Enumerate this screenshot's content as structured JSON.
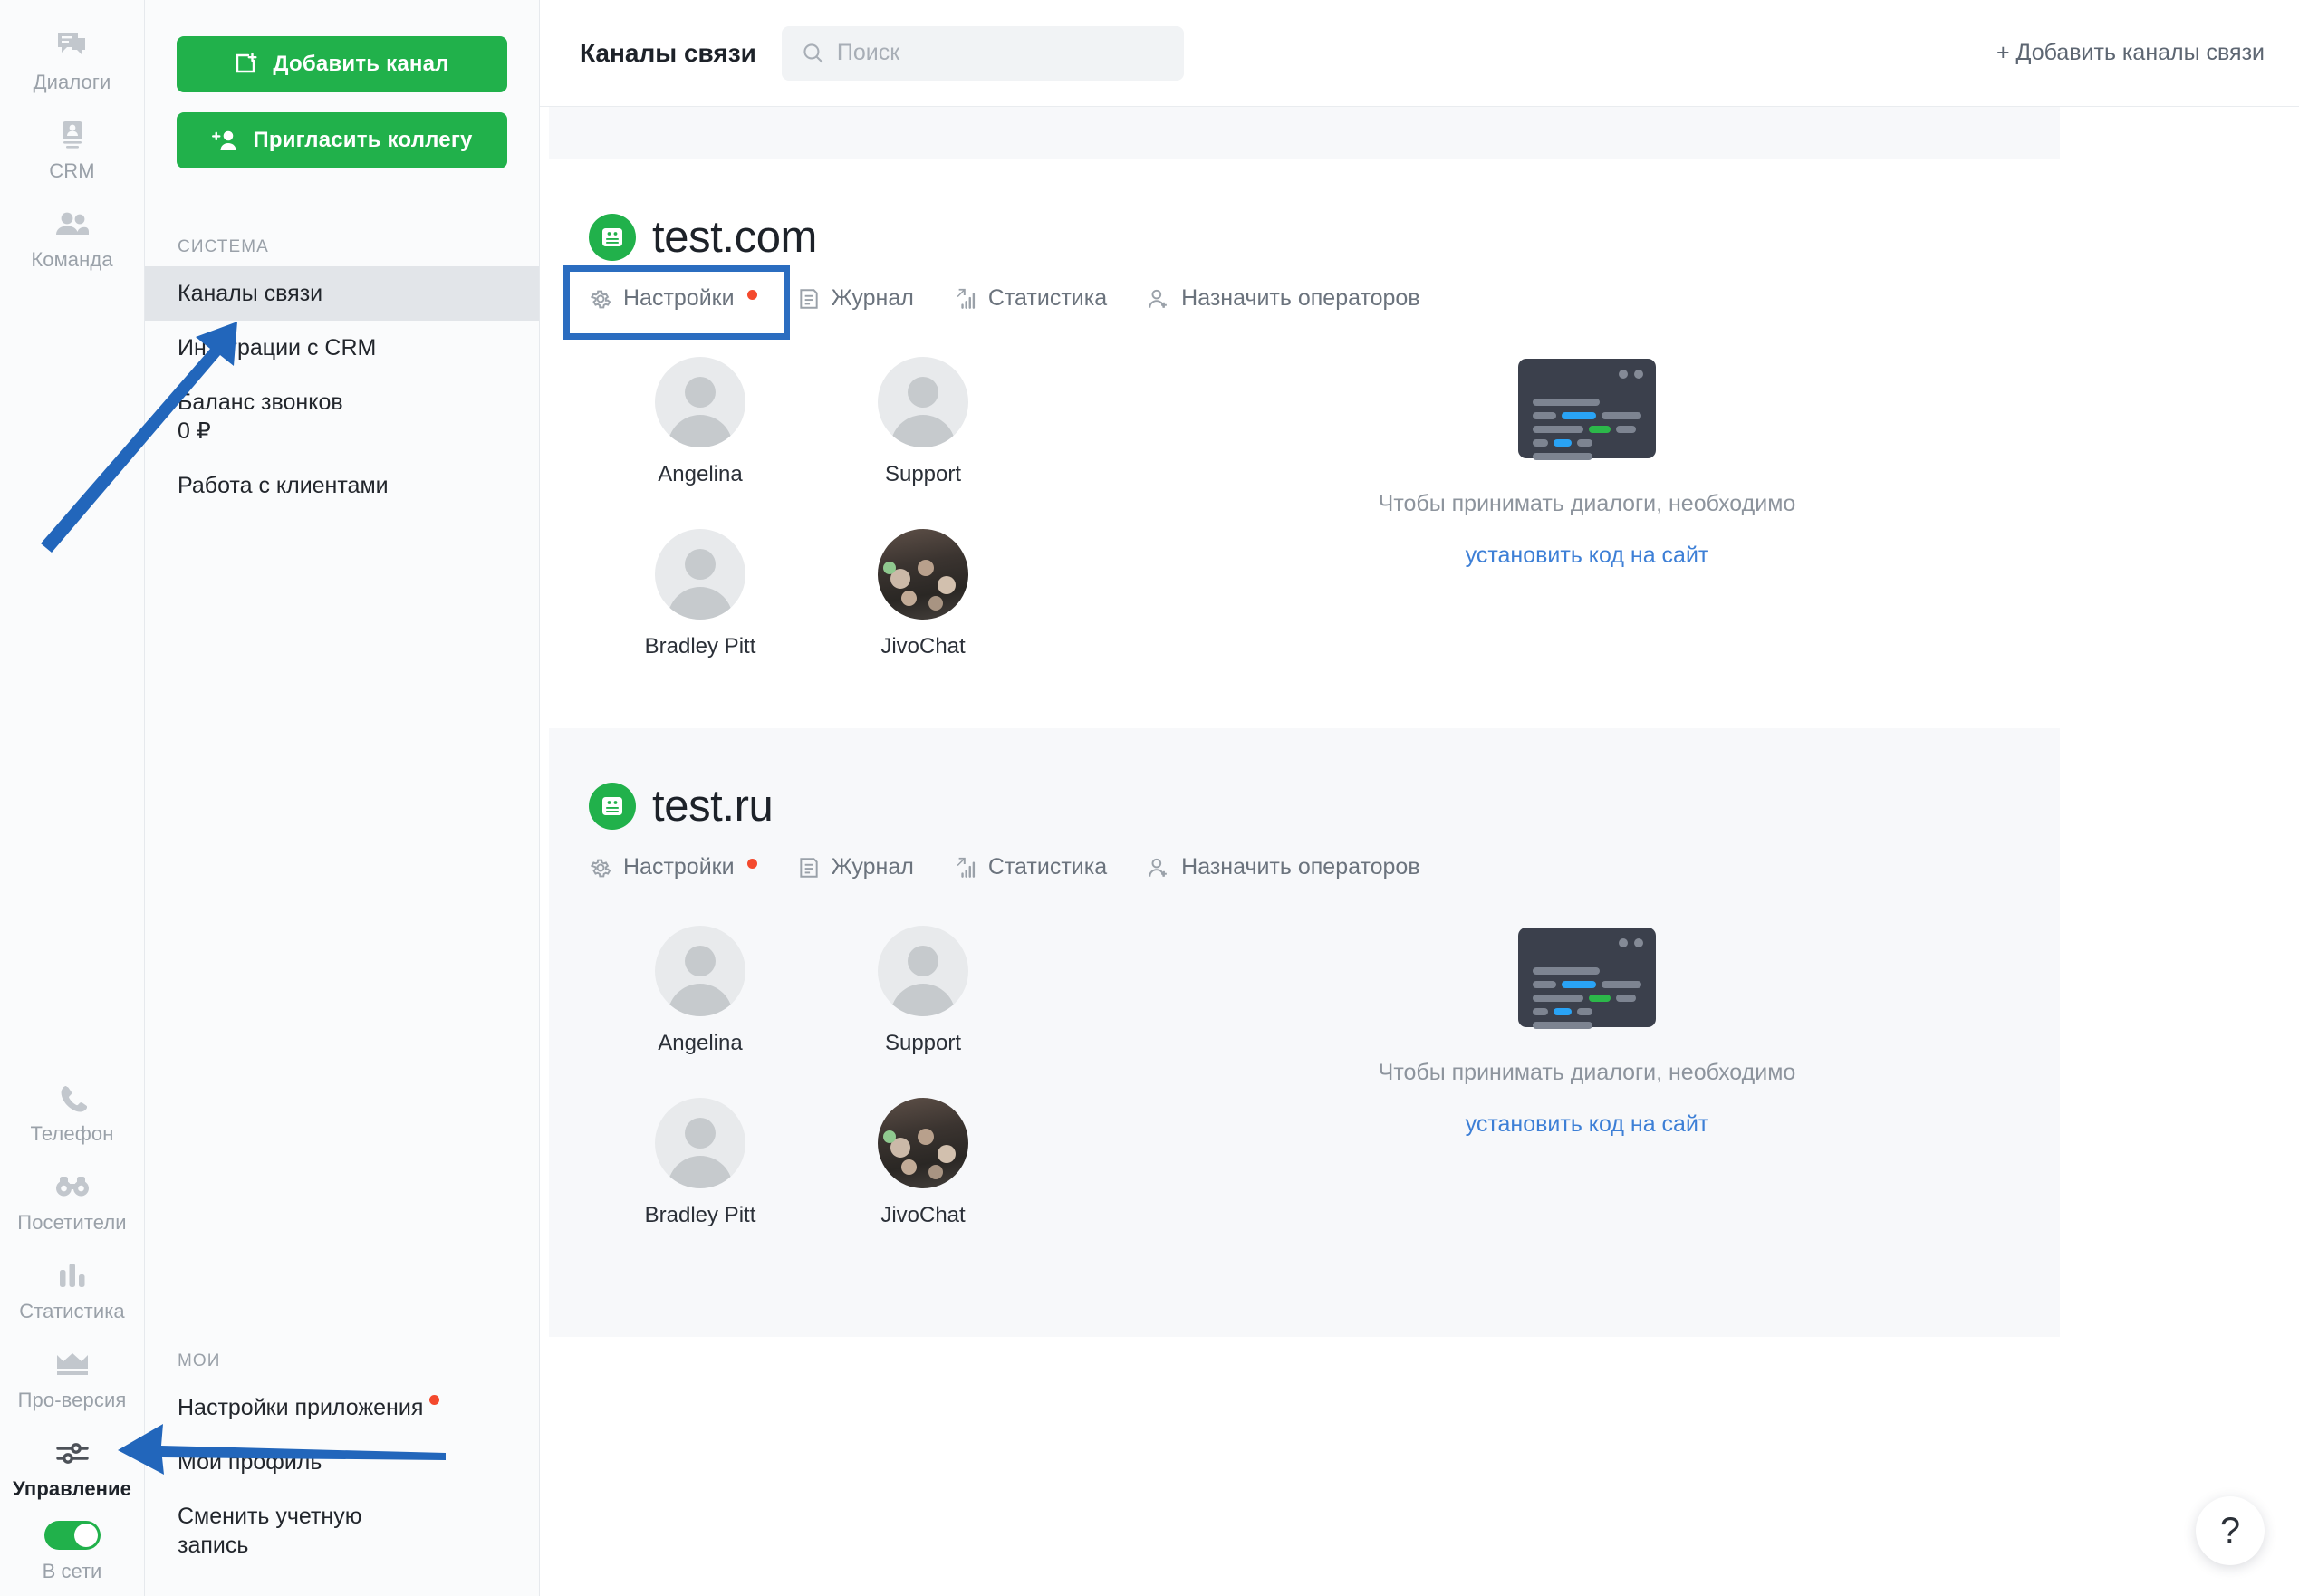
{
  "rail": {
    "items_top": [
      {
        "label": "Диалоги",
        "icon": "chat-icon",
        "active": false
      },
      {
        "label": "CRM",
        "icon": "crm-contact-icon",
        "active": false
      },
      {
        "label": "Команда",
        "icon": "team-people-icon",
        "active": false
      }
    ],
    "items_bottom": [
      {
        "label": "Телефон",
        "icon": "phone-icon",
        "active": false
      },
      {
        "label": "Посетители",
        "icon": "binoculars-icon",
        "active": false
      },
      {
        "label": "Статистика",
        "icon": "bar-chart-icon",
        "active": false
      },
      {
        "label": "Про-версия",
        "icon": "crown-icon",
        "active": false
      },
      {
        "label": "Управление",
        "icon": "sliders-icon",
        "active": true
      }
    ],
    "status_label": "В сети",
    "status_on": true
  },
  "sidebar": {
    "add_channel_label": "Добавить канал",
    "invite_colleague_label": "Пригласить коллегу",
    "system_title": "СИСТЕМА",
    "system_items": [
      {
        "label": "Каналы связи",
        "sub": "",
        "selected": true,
        "badge": false
      },
      {
        "label": "Интеграции с CRM",
        "sub": "",
        "selected": false,
        "badge": false
      },
      {
        "label": "Баланс звонков",
        "sub": "0 ₽",
        "selected": false,
        "badge": false
      },
      {
        "label": "Работа с клиентами",
        "sub": "",
        "selected": false,
        "badge": false
      }
    ],
    "mine_title": "МОИ",
    "mine_items": [
      {
        "label": "Настройки приложения",
        "sub": "",
        "selected": false,
        "badge": true
      },
      {
        "label": "Мой профиль",
        "sub": "",
        "selected": false,
        "badge": false
      },
      {
        "label": "Сменить учетную",
        "sub": "запись",
        "selected": false,
        "badge": false
      }
    ]
  },
  "topbar": {
    "title": "Каналы связи",
    "search_placeholder": "Поиск",
    "search_value": "",
    "add_channels_label": "+ Добавить каналы связи"
  },
  "channels": [
    {
      "name": "test.com",
      "tabs": [
        {
          "label": "Настройки",
          "icon": "gear-icon",
          "badge": true,
          "highlighted": true
        },
        {
          "label": "Журнал",
          "icon": "journal-icon",
          "badge": false,
          "highlighted": false
        },
        {
          "label": "Статистика",
          "icon": "stats-icon",
          "badge": false,
          "highlighted": false
        },
        {
          "label": "Назначить операторов",
          "icon": "add-user-icon",
          "badge": false,
          "highlighted": false
        }
      ],
      "operators": [
        {
          "name": "Angelina",
          "avatar": "placeholder"
        },
        {
          "name": "Support",
          "avatar": "placeholder"
        },
        {
          "name": "Bradley Pitt",
          "avatar": "placeholder"
        },
        {
          "name": "JivoChat",
          "avatar": "photo"
        }
      ],
      "install_text": "Чтобы принимать диалоги, необходимо",
      "install_link": "установить код на сайт"
    },
    {
      "name": "test.ru",
      "tabs": [
        {
          "label": "Настройки",
          "icon": "gear-icon",
          "badge": true,
          "highlighted": false
        },
        {
          "label": "Журнал",
          "icon": "journal-icon",
          "badge": false,
          "highlighted": false
        },
        {
          "label": "Статистика",
          "icon": "stats-icon",
          "badge": false,
          "highlighted": false
        },
        {
          "label": "Назначить операторов",
          "icon": "add-user-icon",
          "badge": false,
          "highlighted": false
        }
      ],
      "operators": [
        {
          "name": "Angelina",
          "avatar": "placeholder"
        },
        {
          "name": "Support",
          "avatar": "placeholder"
        },
        {
          "name": "Bradley Pitt",
          "avatar": "placeholder"
        },
        {
          "name": "JivoChat",
          "avatar": "photo"
        }
      ],
      "install_text": "Чтобы принимать диалоги, необходимо",
      "install_link": "установить код на сайт"
    }
  ],
  "help": {
    "label": "?"
  },
  "colors": {
    "brand_green": "#21b14b",
    "annotation_blue": "#2b6dc0",
    "link_blue": "#3d7fd6",
    "badge_red": "#f4492d"
  }
}
